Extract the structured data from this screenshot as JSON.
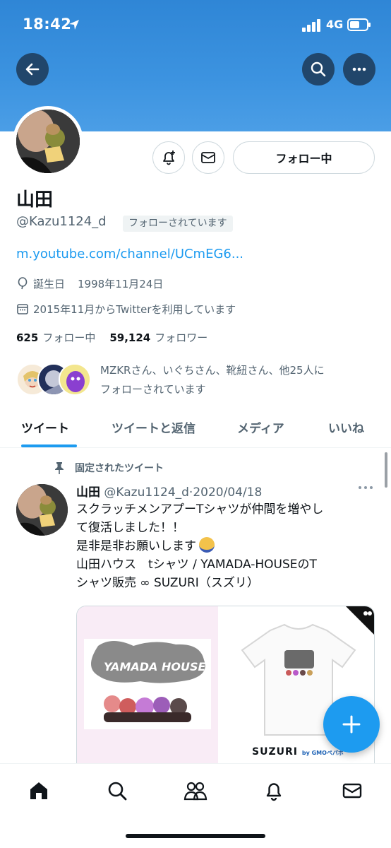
{
  "status_bar": {
    "time": "18:42",
    "network": "4G"
  },
  "profile": {
    "name": "山田",
    "handle": "@Kazu1124_d",
    "follows_you_label": "フォローされています",
    "link": "m.youtube.com/channel/UCmEG6...",
    "birthday_label": "誕生日",
    "birthday": "1998年11月24日",
    "joined": "2015年11月からTwitterを利用しています",
    "following_count": "625",
    "following_label": "フォロー中",
    "followers_count": "59,124",
    "followers_label": "フォロワー",
    "followed_by_line1": "MZKRさん、いぐちさん、靴紐さん、他25人に",
    "followed_by_line2": "フォローされています"
  },
  "actions": {
    "follow_button_label": "フォロー中"
  },
  "tabs": [
    {
      "label": "ツイート"
    },
    {
      "label": "ツイートと返信"
    },
    {
      "label": "メディア"
    },
    {
      "label": "いいね"
    }
  ],
  "tweet": {
    "pinned_label": "固定されたツイート",
    "author": "山田",
    "handle_date": "@Kazu1124_d·2020/04/18",
    "line1": "スクラッチメンアプーTシャツが仲間を増やし",
    "line2": "て復活しました！！",
    "line3": "是非是非お願いします",
    "line4": "山田ハウス　tシャツ / YAMADA-HOUSEのT",
    "line5": "シャツ販売 ∞ SUZURI（スズリ）",
    "media_left_text": "YAMADA HOUSE",
    "media_right_brand": "SUZURI",
    "media_right_sub": "by GMOペパボ"
  },
  "colors": {
    "accent": "#1d9bf0",
    "banner": "#3b8fdd",
    "dark_button": "#21466b"
  },
  "icons": {
    "back": "arrow-left-icon",
    "search": "search-icon",
    "more": "more-icon",
    "notify": "bell-plus-icon",
    "mail": "envelope-icon",
    "home": "home-icon",
    "explore": "search-icon",
    "communities": "people-icon",
    "notifications": "bell-icon",
    "messages": "envelope-icon"
  }
}
